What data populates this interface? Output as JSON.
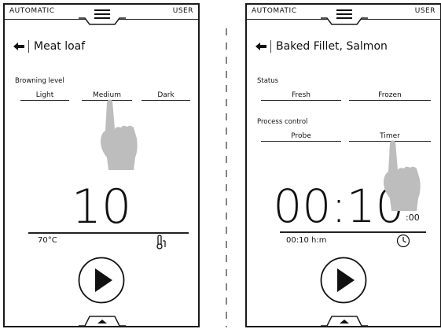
{
  "left": {
    "topbar": {
      "mode": "AUTOMATIC",
      "user": "USER"
    },
    "title": "Meat loaf",
    "section1": {
      "label": "Browning level",
      "options": [
        "Light",
        "Medium",
        "Dark"
      ],
      "selected": "Medium"
    },
    "display": {
      "value": "10",
      "temperature": "70°C"
    },
    "icons": {
      "back": "back-arrow-icon",
      "menu": "hamburger-menu-icon",
      "probe": "thermometer-probe-icon",
      "play": "play-icon",
      "hand": "pointing-hand-icon"
    }
  },
  "right": {
    "topbar": {
      "mode": "AUTOMATIC",
      "user": "USER"
    },
    "title": "Baked Fillet, Salmon",
    "section1": {
      "label": "Status",
      "options": [
        "Fresh",
        "Frozen"
      ]
    },
    "section2": {
      "label": "Process control",
      "options": [
        "Probe",
        "Timer"
      ],
      "selected": "Timer"
    },
    "display": {
      "value": "00:10",
      "seconds": ":00",
      "time": "00:10 h:m"
    },
    "icons": {
      "back": "back-arrow-icon",
      "menu": "hamburger-menu-icon",
      "clock": "clock-icon",
      "play": "play-icon",
      "hand": "pointing-hand-icon"
    }
  }
}
